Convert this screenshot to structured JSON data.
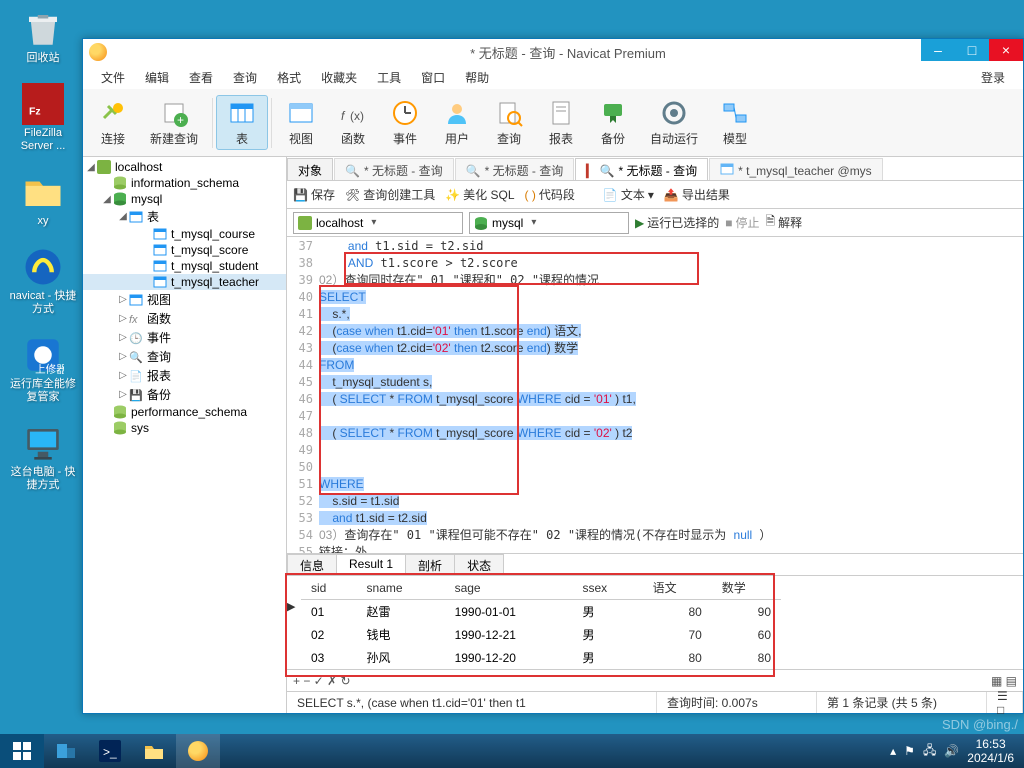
{
  "desktop": {
    "icons": [
      "回收站",
      "FileZilla Server ...",
      "xy",
      "navicat - 快捷方式",
      "运行库全能修复管家",
      "这台电脑 - 快捷方式"
    ]
  },
  "window": {
    "title": "* 无标题 - 查询 - Navicat Premium",
    "controls": {
      "min": "–",
      "max": "□",
      "close": "×"
    },
    "menu": [
      "文件",
      "编辑",
      "查看",
      "查询",
      "格式",
      "收藏夹",
      "工具",
      "窗口",
      "帮助"
    ],
    "login": "登录"
  },
  "ribbon": [
    {
      "label": "连接",
      "icon": "plug"
    },
    {
      "label": "新建查询",
      "icon": "new"
    },
    {
      "label": "表",
      "icon": "table",
      "active": true
    },
    {
      "label": "视图",
      "icon": "view"
    },
    {
      "label": "函数",
      "icon": "fx"
    },
    {
      "label": "事件",
      "icon": "clock"
    },
    {
      "label": "用户",
      "icon": "user"
    },
    {
      "label": "查询",
      "icon": "query"
    },
    {
      "label": "报表",
      "icon": "report"
    },
    {
      "label": "备份",
      "icon": "backup"
    },
    {
      "label": "自动运行",
      "icon": "auto"
    },
    {
      "label": "模型",
      "icon": "model"
    }
  ],
  "tree": {
    "root": "localhost",
    "dbs": [
      {
        "name": "information_schema"
      },
      {
        "name": "mysql",
        "open": true,
        "children": [
          {
            "name": "表",
            "open": true,
            "tables": [
              "t_mysql_course",
              "t_mysql_score",
              "t_mysql_student",
              "t_mysql_teacher"
            ]
          },
          {
            "name": "视图"
          },
          {
            "name": "函数"
          },
          {
            "name": "事件"
          },
          {
            "name": "查询"
          },
          {
            "name": "报表"
          },
          {
            "name": "备份"
          }
        ]
      },
      {
        "name": "performance_schema"
      },
      {
        "name": "sys"
      }
    ]
  },
  "tabs": [
    {
      "label": "对象"
    },
    {
      "label": "* 无标题 - 查询",
      "dim": true
    },
    {
      "label": "* 无标题 - 查询",
      "dim": true
    },
    {
      "label": "* 无标题 - 查询",
      "active": true,
      "red": true
    },
    {
      "label": "t_mysql_teacher @mys",
      "dim": true
    }
  ],
  "qtoolbar": {
    "save": "保存",
    "builder": "查询创建工具",
    "beautify": "美化 SQL",
    "snippet": "代码段",
    "text": "文本",
    "export": "导出结果"
  },
  "connbar": {
    "conn": "localhost",
    "db": "mysql",
    "run": "运行已选择的",
    "stop": "停止",
    "explain": "解释"
  },
  "code": {
    "start": 37,
    "lines": [
      "    and t1.sid = t2.sid",
      "    AND t1.score > t2.score",
      "02）查询同时存在\" 01 \"课程和\" 02 \"课程的情况",
      "SELECT",
      "    s.*,",
      "    (case when t1.cid='01' then t1.score end) 语文,",
      "    (case when t2.cid='02' then t2.score end) 数学",
      "FROM",
      "    t_mysql_student s,",
      "    ( SELECT * FROM t_mysql_score WHERE cid = '01' ) t1,",
      "",
      "    ( SELECT * FROM t_mysql_score WHERE cid = '02' ) t2",
      "",
      "",
      "WHERE",
      "    s.sid = t1.sid",
      "    and t1.sid = t2.sid",
      "03）查询存在\" 01 \"课程但可能不存在\" 02 \"课程的情况(不存在时显示为 null ）",
      "链接：外"
    ]
  },
  "result_tabs": [
    "信息",
    "Result 1",
    "剖析",
    "状态"
  ],
  "grid": {
    "cols": [
      "sid",
      "sname",
      "sage",
      "ssex",
      "语文",
      "数学"
    ],
    "rows": [
      [
        "01",
        "赵雷",
        "1990-01-01",
        "男",
        "80",
        "90"
      ],
      [
        "02",
        "钱电",
        "1990-12-21",
        "男",
        "70",
        "60"
      ],
      [
        "03",
        "孙风",
        "1990-12-20",
        "男",
        "80",
        "80"
      ]
    ]
  },
  "gridnav": {
    "btns": "+  −  ✓  ✗  ↻"
  },
  "status": {
    "sql": "SELECT   s.*,      (case when t1.cid='01' then t1",
    "time": "查询时间: 0.007s",
    "rec": "第 1 条记录 (共 5 条)"
  },
  "tray": {
    "time": "16:53",
    "date": "2024/1/6",
    "wm": "SDN @bing./"
  }
}
